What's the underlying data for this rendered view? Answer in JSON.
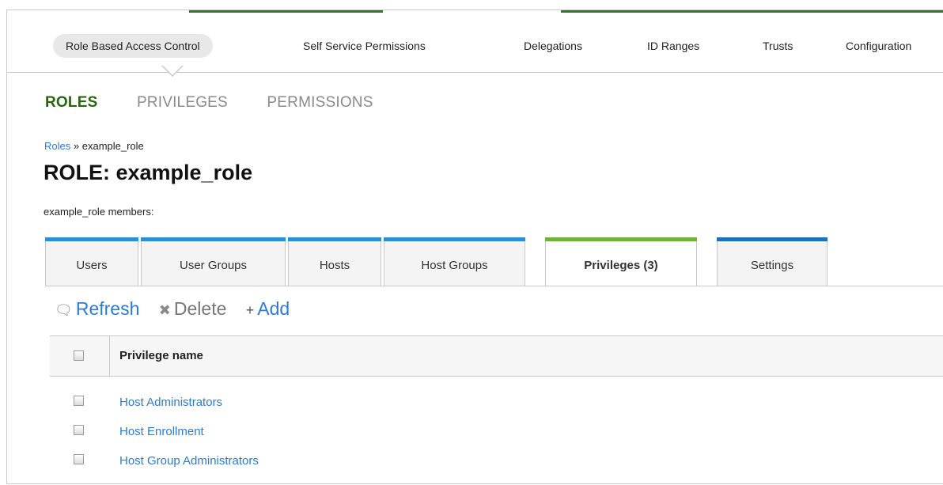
{
  "main_nav": {
    "items": [
      {
        "label": "Role Based Access Control",
        "active": true
      },
      {
        "label": "Self Service Permissions",
        "active": false
      },
      {
        "label": "Delegations",
        "active": false
      },
      {
        "label": "ID Ranges",
        "active": false
      },
      {
        "label": "Trusts",
        "active": false
      },
      {
        "label": "Configuration",
        "active": false
      }
    ]
  },
  "sub_nav": {
    "items": [
      {
        "label": "ROLES",
        "active": true
      },
      {
        "label": "PRIVILEGES",
        "active": false
      },
      {
        "label": "PERMISSIONS",
        "active": false
      }
    ]
  },
  "breadcrumb": {
    "parent": "Roles",
    "separator": "»",
    "current": "example_role"
  },
  "page": {
    "title": "ROLE: example_role",
    "members_label": "example_role members:"
  },
  "tabs": [
    {
      "label": "Users"
    },
    {
      "label": "User Groups"
    },
    {
      "label": "Hosts"
    },
    {
      "label": "Host Groups"
    },
    {
      "label": "Privileges (3)",
      "active": true
    },
    {
      "label": "Settings"
    }
  ],
  "toolbar": {
    "refresh_label": "Refresh",
    "delete_label": "Delete",
    "add_label": "Add",
    "refresh_icon": "refresh-icon",
    "delete_icon": "x-icon",
    "add_icon": "plus-icon"
  },
  "table": {
    "column_header": "Privilege name",
    "rows": [
      {
        "name": "Host Administrators"
      },
      {
        "name": "Host Enrollment"
      },
      {
        "name": "Host Group Administrators"
      }
    ]
  },
  "colors": {
    "active_green": "#2b6411",
    "link_blue": "#2e7bcf",
    "tab_stripe_blue": "#2a8fd6",
    "tab_stripe_green": "#6db33f"
  }
}
